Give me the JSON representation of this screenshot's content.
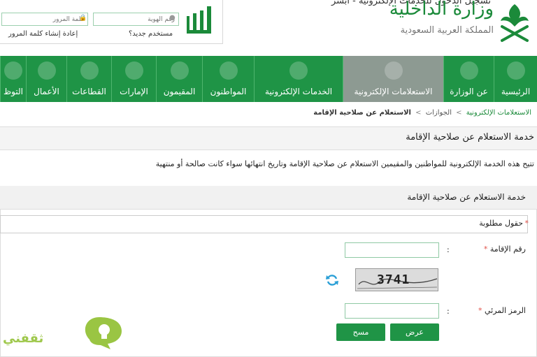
{
  "login": {
    "title": "تسجيل الدخول للخدمات الإلكترونية - أبشر",
    "password_placeholder": "كلمة المرور",
    "id_placeholder": "رقم الهوية",
    "new_user": "مستخدم جديد؟",
    "reset_password": "إعادة إنشاء كلمة المرور"
  },
  "brand": {
    "ministry": "وزارة الداخلية",
    "kingdom": "المملكة العربية السعودية",
    "absher_logo_text": "أبشر"
  },
  "nav": {
    "items": [
      {
        "label": "الرئيسية",
        "icon": "home-icon"
      },
      {
        "label": "عن الوزارة",
        "icon": "emblem-icon"
      },
      {
        "label": "الاستعلامات الإلكترونية",
        "icon": "globe-search-icon",
        "active": true
      },
      {
        "label": "الخدمات الإلكترونية",
        "icon": "globe-icon"
      },
      {
        "label": "المواطنون",
        "icon": "citizen-icon"
      },
      {
        "label": "المقيمون",
        "icon": "residents-icon"
      },
      {
        "label": "الإمارات",
        "icon": "regions-icon"
      },
      {
        "label": "القطاعات",
        "icon": "network-icon"
      },
      {
        "label": "الأعمال",
        "icon": "briefcase-icon"
      },
      {
        "label": "التوظ",
        "icon": "employment-icon"
      }
    ]
  },
  "breadcrumb": {
    "items": [
      "الاستعلامات الإلكترونية",
      "الجوازات",
      "الاستعلام عن صلاحية الإقامة"
    ],
    "separator": ">"
  },
  "page": {
    "title": "خدمة الاستعلام عن صلاحية الإقامة",
    "description": "تتيح هذه الخدمة الإلكترونية للمواطنين والمقيمين الاستعلام عن صلاحية الإقامة وتاريخ انتهائها سواء كانت صالحة أو منتهية"
  },
  "form": {
    "panel_title": "خدمة الاستعلام عن صلاحية الإقامة",
    "required_note": "حقول مطلوبة",
    "iqama_label": "رقم الإقامة",
    "captcha_label": "الرمز المرئي",
    "colon": ":",
    "star": "*",
    "captcha_text": "3741",
    "view_button": "عرض",
    "clear_button": "مسح"
  },
  "watermark": {
    "text": "ثقفني"
  },
  "colors": {
    "nav_green": "#1f9446",
    "nav_active": "#8d9a92",
    "brand_green": "#1b8a3a",
    "required_red": "#e2534a"
  }
}
